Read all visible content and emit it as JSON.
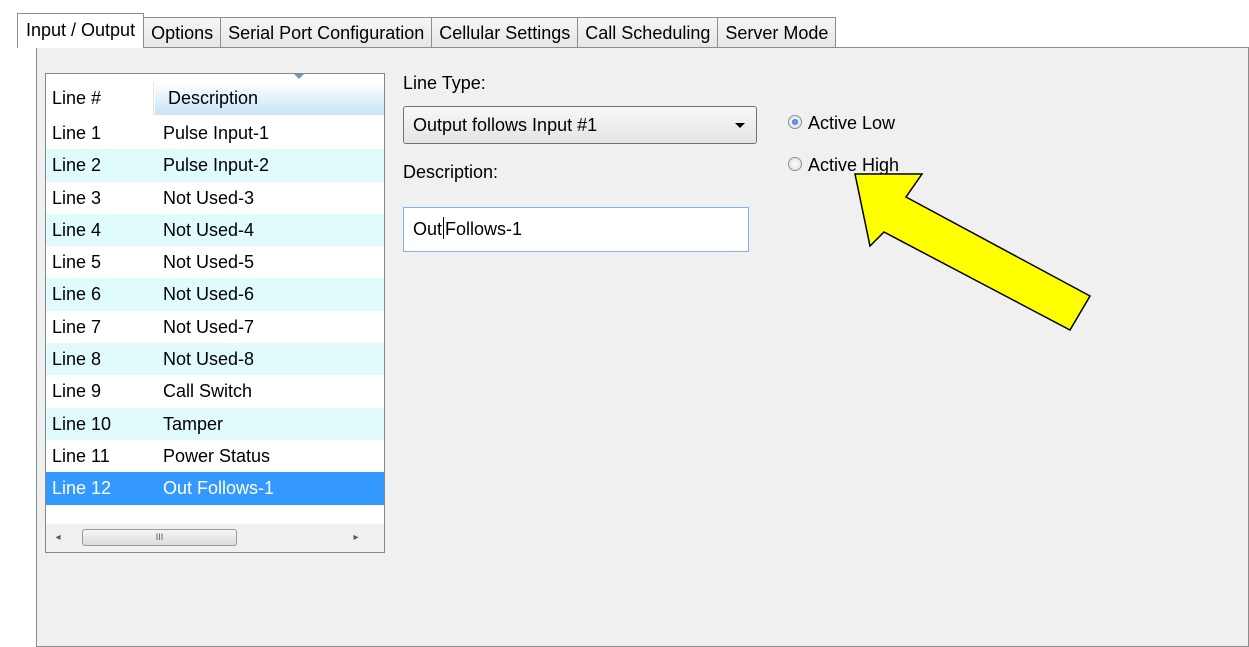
{
  "tabs": [
    {
      "label": "Input / Output",
      "active": true
    },
    {
      "label": "Options",
      "active": false
    },
    {
      "label": "Serial Port Configuration",
      "active": false
    },
    {
      "label": "Cellular Settings",
      "active": false
    },
    {
      "label": "Call Scheduling",
      "active": false
    },
    {
      "label": "Server Mode",
      "active": false
    }
  ],
  "listview": {
    "columns": [
      "Line #",
      "Description"
    ],
    "rows": [
      {
        "line": "Line 1",
        "description": "Pulse Input-1"
      },
      {
        "line": "Line 2",
        "description": "Pulse Input-2"
      },
      {
        "line": "Line 3",
        "description": "Not Used-3"
      },
      {
        "line": "Line 4",
        "description": "Not Used-4"
      },
      {
        "line": "Line 5",
        "description": "Not Used-5"
      },
      {
        "line": "Line 6",
        "description": "Not Used-6"
      },
      {
        "line": "Line 7",
        "description": "Not Used-7"
      },
      {
        "line": "Line 8",
        "description": "Not Used-8"
      },
      {
        "line": "Line 9",
        "description": "Call Switch"
      },
      {
        "line": "Line 10",
        "description": "Tamper"
      },
      {
        "line": "Line 11",
        "description": "Power Status"
      },
      {
        "line": "Line 12",
        "description": "Out Follows-1"
      }
    ],
    "selected_row": "Line 12",
    "scrollbar": {
      "left_arrow": "◂",
      "right_arrow": "▸",
      "grip": "III"
    }
  },
  "form": {
    "line_type_label": "Line Type:",
    "line_type_value": "Output follows Input #1",
    "description_label": "Description:",
    "description_value_before_caret": "Out",
    "description_value_after_caret": "Follows-1",
    "radio_options": [
      {
        "label": "Active Low",
        "checked": true
      },
      {
        "label": "Active High",
        "checked": false
      }
    ]
  },
  "annotation": {
    "arrow_color": "#ffff00",
    "arrow_outline": "#000000"
  },
  "colors": {
    "selection": "#3399ff",
    "alt_row": "#e0fbfb",
    "panel_bg": "#f0f0f0"
  }
}
